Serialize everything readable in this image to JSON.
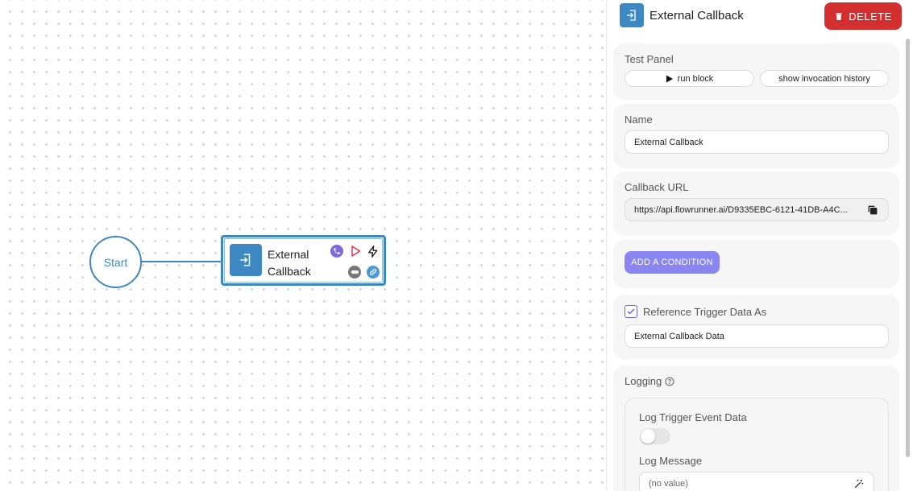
{
  "canvas": {
    "start_label": "Start",
    "block": {
      "title": "External Callback"
    }
  },
  "panel": {
    "header": {
      "title": "External Callback",
      "delete_label": "DELETE"
    },
    "test_panel": {
      "label": "Test Panel",
      "run_label": "run block",
      "history_label": "show invocation history"
    },
    "name": {
      "label": "Name",
      "value": "External Callback"
    },
    "callback": {
      "label": "Callback URL",
      "value": "https://api.flowrunner.ai/D9335EBC-6121-41DB-A4C..."
    },
    "condition": {
      "button_label": "ADD A CONDITION"
    },
    "reference": {
      "label": "Reference Trigger Data As",
      "checked": true,
      "value": "External Callback Data"
    },
    "logging": {
      "label": "Logging",
      "log_trigger_label": "Log Trigger Event Data",
      "log_trigger_enabled": false,
      "log_message_label": "Log Message",
      "log_message_placeholder": "(no value)"
    }
  },
  "colors": {
    "accent_blue": "#3d87c3",
    "delete_red": "#d32f2f",
    "condition_purple": "#8a85f0"
  },
  "icons": [
    "login-icon",
    "phone-icon",
    "play-outline-icon",
    "lightning-icon",
    "mask-icon",
    "link-icon",
    "trash-icon",
    "play-icon",
    "copy-icon",
    "check-icon",
    "help-circle-icon",
    "magic-wand-icon"
  ]
}
